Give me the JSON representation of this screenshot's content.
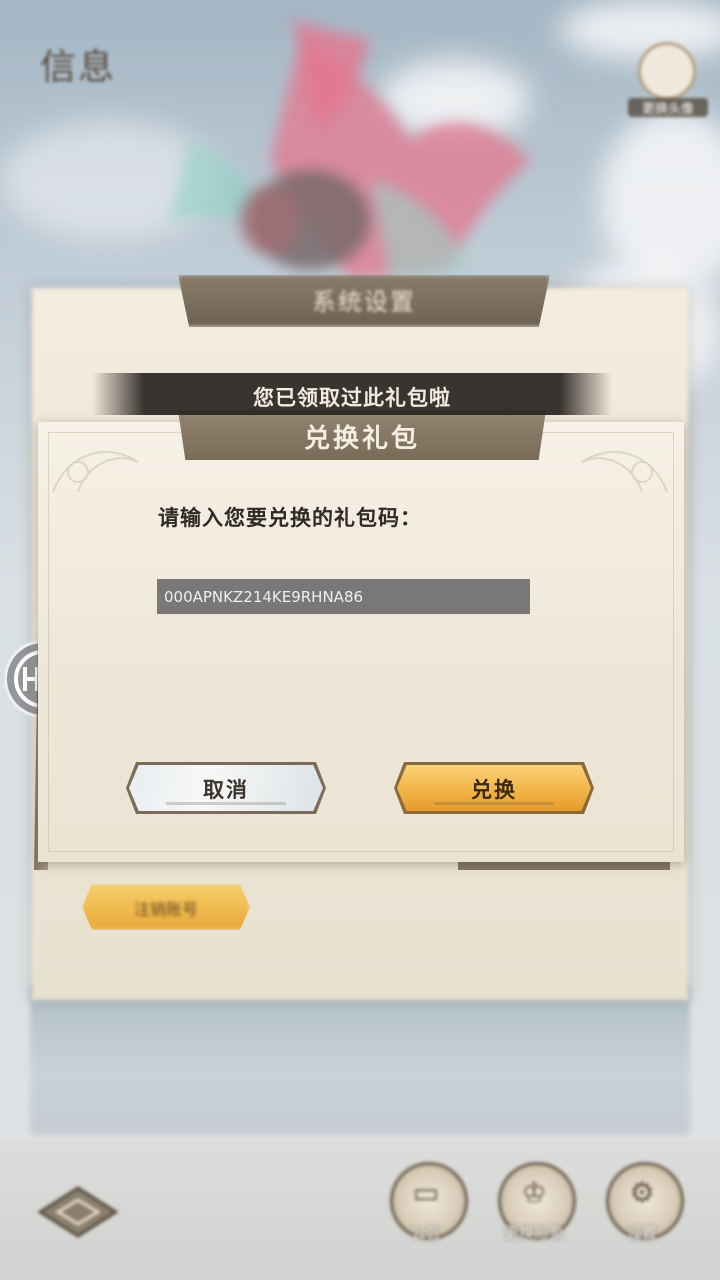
{
  "header": {
    "logo_text": "信息",
    "profile_label": "更换头像"
  },
  "settings_panel": {
    "title": "系统设置",
    "logout_label": "注销账号"
  },
  "toast": {
    "message": "您已领取过此礼包啦"
  },
  "redeem_dialog": {
    "title": "兑换礼包",
    "prompt": "请输入您要兑换的礼包码：",
    "code_value": "000APNKZ214KE9RHNA86",
    "cancel_label": "取消",
    "confirm_label": "兑换"
  },
  "bottom_nav": {
    "items": [
      {
        "label": "公告",
        "icon": "notice-icon"
      },
      {
        "label": "更换形象",
        "icon": "costume-icon"
      },
      {
        "label": "设置",
        "icon": "gear-icon"
      }
    ]
  },
  "float_button": {
    "icon": "h24-assistant-icon"
  },
  "colors": {
    "toast_bg": "#2a2520",
    "title_bar": "#857562",
    "confirm_button": "#f2b547",
    "cancel_button": "#eef1f2",
    "input_bg": "#7a7778"
  }
}
